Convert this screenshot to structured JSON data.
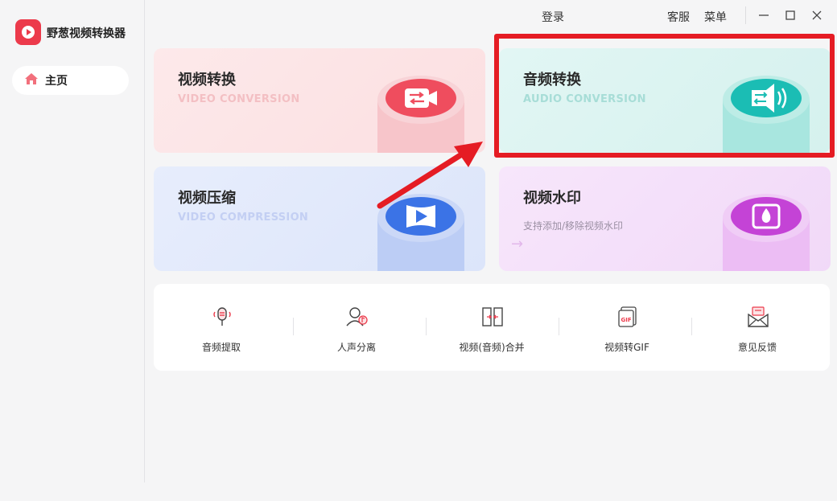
{
  "app": {
    "title": "野葱视频转换器",
    "brand_color": "#ec3a4b"
  },
  "sidebar": {
    "items": [
      {
        "label": "主页",
        "icon": "home-icon",
        "active": true
      }
    ]
  },
  "topbar": {
    "login": "登录",
    "support": "客服",
    "menu": "菜单",
    "window_controls": [
      "minimize-icon",
      "maximize-icon",
      "close-icon"
    ]
  },
  "cards": {
    "video_conversion": {
      "title": "视频转换",
      "subtitle": "VIDEO CONVERSION",
      "icon": "video-convert-icon",
      "color": "#ef4d5e"
    },
    "audio_conversion": {
      "title": "音频转换",
      "subtitle": "AUDIO CONVERSION",
      "icon": "speaker-convert-icon",
      "color": "#1bbdb4"
    },
    "video_compression": {
      "title": "视频压缩",
      "subtitle": "VIDEO COMPRESSION",
      "icon": "video-compress-icon",
      "color": "#3b73e6"
    },
    "video_watermark": {
      "title": "视频水印",
      "desc": "支持添加/移除视频水印",
      "icon": "watermark-icon",
      "color": "#c443d6"
    }
  },
  "tools": [
    {
      "label": "音频提取",
      "icon": "microphone-icon"
    },
    {
      "label": "人声分离",
      "icon": "voice-separate-icon"
    },
    {
      "label": "视频(音频)合并",
      "icon": "merge-icon"
    },
    {
      "label": "视频转GIF",
      "icon": "gif-icon"
    },
    {
      "label": "意见反馈",
      "icon": "feedback-mail-icon"
    }
  ],
  "annotation": {
    "highlight_color": "#e51c24"
  }
}
